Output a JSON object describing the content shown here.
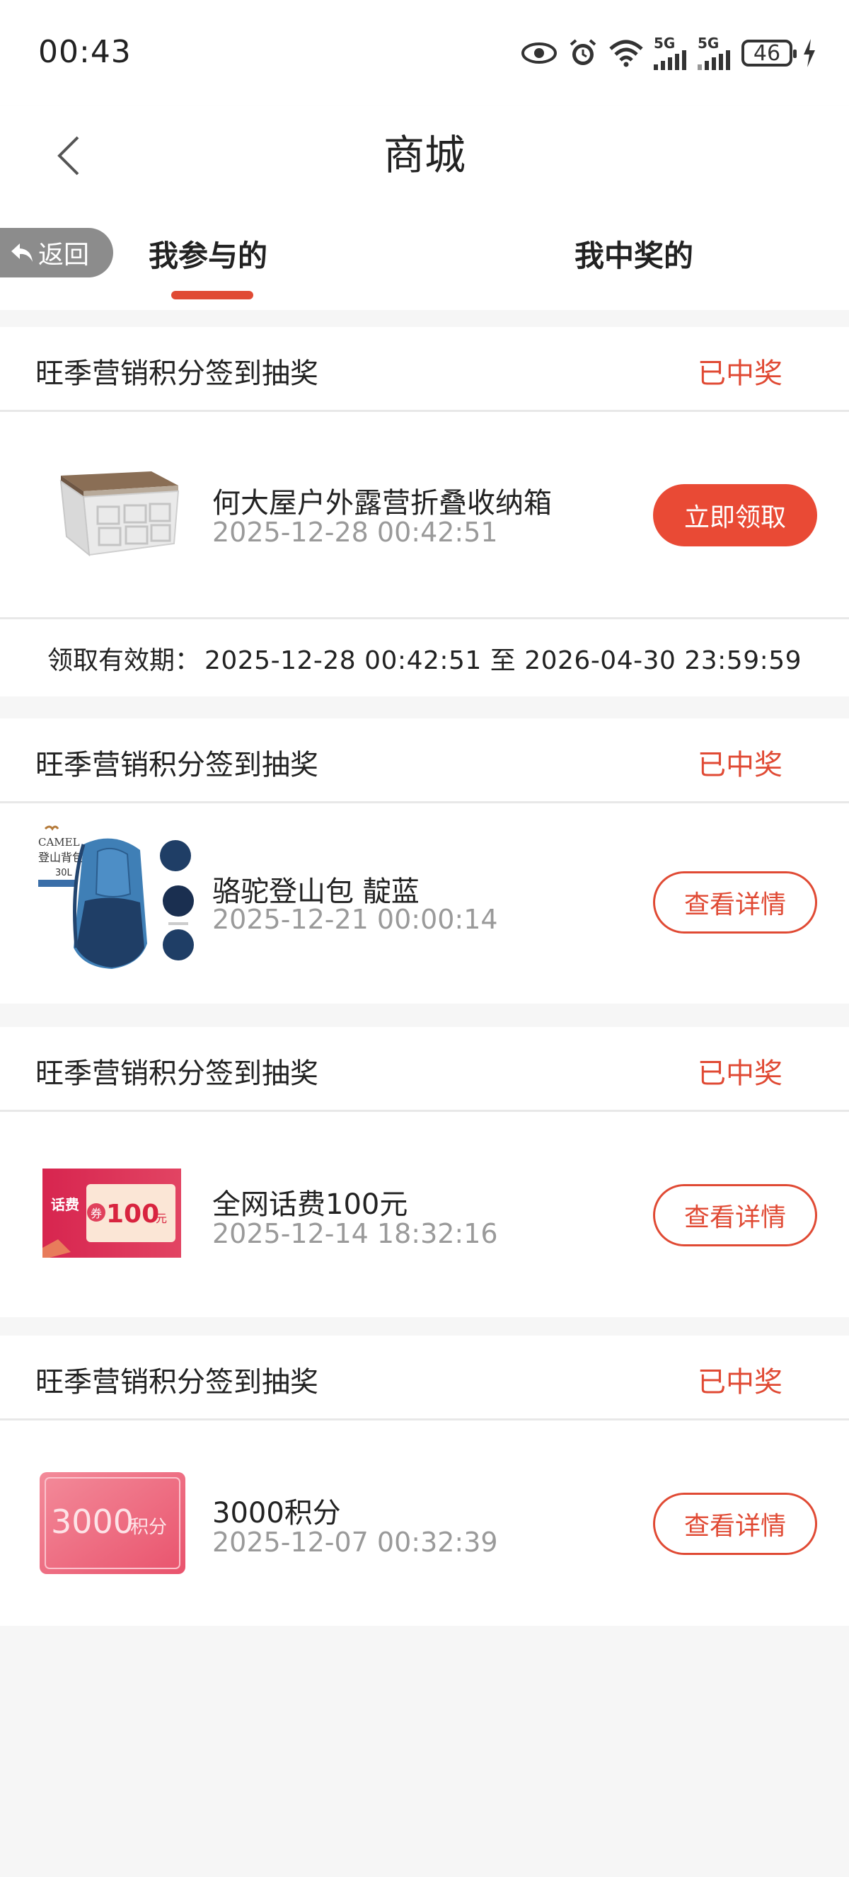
{
  "status_bar": {
    "time": "00:43",
    "signal1_label": "5G",
    "signal2_label": "5G",
    "battery": "46",
    "icons": [
      "eye-icon",
      "alarm-icon",
      "wifi-icon",
      "signal-icon",
      "signal-icon",
      "battery-icon",
      "charging-icon"
    ]
  },
  "header": {
    "title": "商城"
  },
  "return_button": {
    "label": "返回"
  },
  "tabs": [
    {
      "label": "我参与的",
      "active": true
    },
    {
      "label": "我中奖的",
      "active": false
    }
  ],
  "colors": {
    "accent": "#e04a34",
    "muted": "#9a9a9a",
    "background": "#f6f6f6"
  },
  "records": [
    {
      "event": "旺季营销积分签到抽奖",
      "status": "已中奖",
      "item": "何大屋户外露营折叠收纳箱",
      "time": "2025-12-28 00:42:51",
      "button": "立即领取",
      "thumbnail": "storage-box",
      "validity_label": "领取有效期：",
      "validity_range": "2025-12-28 00:42:51 至 2026-04-30 23:59:59"
    },
    {
      "event": "旺季营销积分签到抽奖",
      "status": "已中奖",
      "item": "骆驼登山包 靛蓝",
      "time": "2025-12-21 00:00:14",
      "button": "查看详情",
      "thumbnail": "backpack",
      "thumb_brand": "CAMEL",
      "thumb_name": "登山背包",
      "thumb_capacity": "30L"
    },
    {
      "event": "旺季营销积分签到抽奖",
      "status": "已中奖",
      "item": "全网话费100元",
      "time": "2025-12-14 18:32:16",
      "button": "查看详情",
      "thumbnail": "phone-credit-coupon",
      "thumb_tag": "话费",
      "thumb_quan": "券",
      "thumb_amount": "100",
      "thumb_unit": "元"
    },
    {
      "event": "旺季营销积分签到抽奖",
      "status": "已中奖",
      "item": "3000积分",
      "time": "2025-12-07 00:32:39",
      "button": "查看详情",
      "thumbnail": "points-card",
      "thumb_amount": "3000",
      "thumb_unit": "积分"
    }
  ]
}
